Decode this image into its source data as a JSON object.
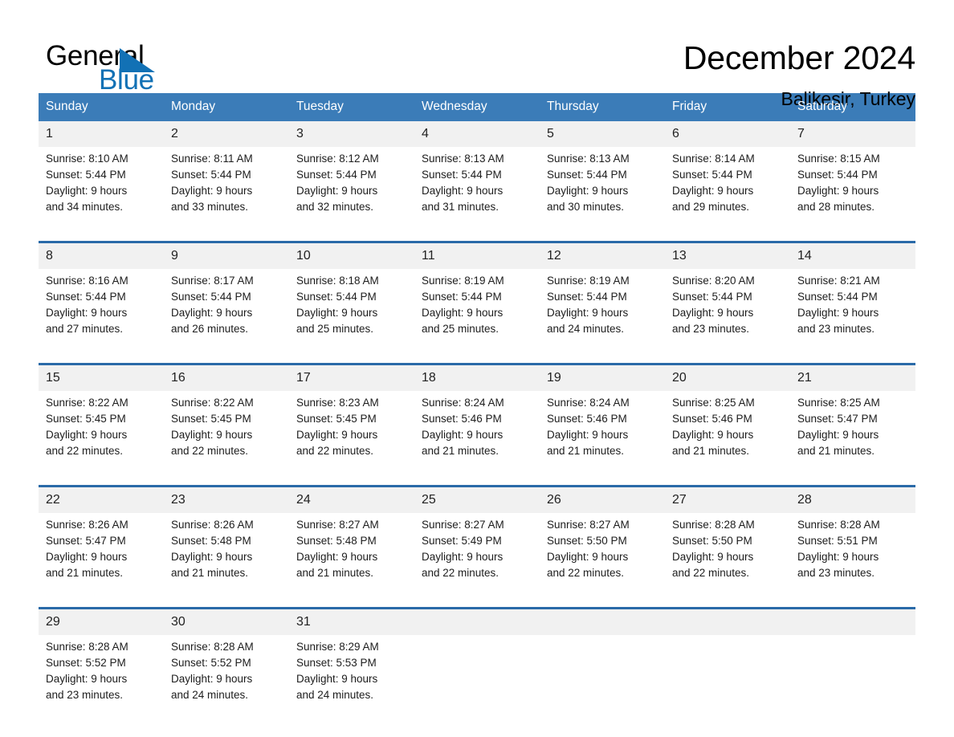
{
  "brand": {
    "name_part1": "General",
    "name_part2": "Blue",
    "accent_color": "#1271B5"
  },
  "header": {
    "month_title": "December 2024",
    "location_title": "Balikesir, Turkey"
  },
  "calendar": {
    "header_bg": "#3B7CB8",
    "row_divider_color": "#2A6AA8",
    "daynum_bg": "#F1F1F1",
    "weekdays": [
      "Sunday",
      "Monday",
      "Tuesday",
      "Wednesday",
      "Thursday",
      "Friday",
      "Saturday"
    ],
    "weeks": [
      {
        "days": [
          {
            "num": "1",
            "sunrise": "Sunrise: 8:10 AM",
            "sunset": "Sunset: 5:44 PM",
            "daylight1": "Daylight: 9 hours",
            "daylight2": "and 34 minutes."
          },
          {
            "num": "2",
            "sunrise": "Sunrise: 8:11 AM",
            "sunset": "Sunset: 5:44 PM",
            "daylight1": "Daylight: 9 hours",
            "daylight2": "and 33 minutes."
          },
          {
            "num": "3",
            "sunrise": "Sunrise: 8:12 AM",
            "sunset": "Sunset: 5:44 PM",
            "daylight1": "Daylight: 9 hours",
            "daylight2": "and 32 minutes."
          },
          {
            "num": "4",
            "sunrise": "Sunrise: 8:13 AM",
            "sunset": "Sunset: 5:44 PM",
            "daylight1": "Daylight: 9 hours",
            "daylight2": "and 31 minutes."
          },
          {
            "num": "5",
            "sunrise": "Sunrise: 8:13 AM",
            "sunset": "Sunset: 5:44 PM",
            "daylight1": "Daylight: 9 hours",
            "daylight2": "and 30 minutes."
          },
          {
            "num": "6",
            "sunrise": "Sunrise: 8:14 AM",
            "sunset": "Sunset: 5:44 PM",
            "daylight1": "Daylight: 9 hours",
            "daylight2": "and 29 minutes."
          },
          {
            "num": "7",
            "sunrise": "Sunrise: 8:15 AM",
            "sunset": "Sunset: 5:44 PM",
            "daylight1": "Daylight: 9 hours",
            "daylight2": "and 28 minutes."
          }
        ]
      },
      {
        "days": [
          {
            "num": "8",
            "sunrise": "Sunrise: 8:16 AM",
            "sunset": "Sunset: 5:44 PM",
            "daylight1": "Daylight: 9 hours",
            "daylight2": "and 27 minutes."
          },
          {
            "num": "9",
            "sunrise": "Sunrise: 8:17 AM",
            "sunset": "Sunset: 5:44 PM",
            "daylight1": "Daylight: 9 hours",
            "daylight2": "and 26 minutes."
          },
          {
            "num": "10",
            "sunrise": "Sunrise: 8:18 AM",
            "sunset": "Sunset: 5:44 PM",
            "daylight1": "Daylight: 9 hours",
            "daylight2": "and 25 minutes."
          },
          {
            "num": "11",
            "sunrise": "Sunrise: 8:19 AM",
            "sunset": "Sunset: 5:44 PM",
            "daylight1": "Daylight: 9 hours",
            "daylight2": "and 25 minutes."
          },
          {
            "num": "12",
            "sunrise": "Sunrise: 8:19 AM",
            "sunset": "Sunset: 5:44 PM",
            "daylight1": "Daylight: 9 hours",
            "daylight2": "and 24 minutes."
          },
          {
            "num": "13",
            "sunrise": "Sunrise: 8:20 AM",
            "sunset": "Sunset: 5:44 PM",
            "daylight1": "Daylight: 9 hours",
            "daylight2": "and 23 minutes."
          },
          {
            "num": "14",
            "sunrise": "Sunrise: 8:21 AM",
            "sunset": "Sunset: 5:44 PM",
            "daylight1": "Daylight: 9 hours",
            "daylight2": "and 23 minutes."
          }
        ]
      },
      {
        "days": [
          {
            "num": "15",
            "sunrise": "Sunrise: 8:22 AM",
            "sunset": "Sunset: 5:45 PM",
            "daylight1": "Daylight: 9 hours",
            "daylight2": "and 22 minutes."
          },
          {
            "num": "16",
            "sunrise": "Sunrise: 8:22 AM",
            "sunset": "Sunset: 5:45 PM",
            "daylight1": "Daylight: 9 hours",
            "daylight2": "and 22 minutes."
          },
          {
            "num": "17",
            "sunrise": "Sunrise: 8:23 AM",
            "sunset": "Sunset: 5:45 PM",
            "daylight1": "Daylight: 9 hours",
            "daylight2": "and 22 minutes."
          },
          {
            "num": "18",
            "sunrise": "Sunrise: 8:24 AM",
            "sunset": "Sunset: 5:46 PM",
            "daylight1": "Daylight: 9 hours",
            "daylight2": "and 21 minutes."
          },
          {
            "num": "19",
            "sunrise": "Sunrise: 8:24 AM",
            "sunset": "Sunset: 5:46 PM",
            "daylight1": "Daylight: 9 hours",
            "daylight2": "and 21 minutes."
          },
          {
            "num": "20",
            "sunrise": "Sunrise: 8:25 AM",
            "sunset": "Sunset: 5:46 PM",
            "daylight1": "Daylight: 9 hours",
            "daylight2": "and 21 minutes."
          },
          {
            "num": "21",
            "sunrise": "Sunrise: 8:25 AM",
            "sunset": "Sunset: 5:47 PM",
            "daylight1": "Daylight: 9 hours",
            "daylight2": "and 21 minutes."
          }
        ]
      },
      {
        "days": [
          {
            "num": "22",
            "sunrise": "Sunrise: 8:26 AM",
            "sunset": "Sunset: 5:47 PM",
            "daylight1": "Daylight: 9 hours",
            "daylight2": "and 21 minutes."
          },
          {
            "num": "23",
            "sunrise": "Sunrise: 8:26 AM",
            "sunset": "Sunset: 5:48 PM",
            "daylight1": "Daylight: 9 hours",
            "daylight2": "and 21 minutes."
          },
          {
            "num": "24",
            "sunrise": "Sunrise: 8:27 AM",
            "sunset": "Sunset: 5:48 PM",
            "daylight1": "Daylight: 9 hours",
            "daylight2": "and 21 minutes."
          },
          {
            "num": "25",
            "sunrise": "Sunrise: 8:27 AM",
            "sunset": "Sunset: 5:49 PM",
            "daylight1": "Daylight: 9 hours",
            "daylight2": "and 22 minutes."
          },
          {
            "num": "26",
            "sunrise": "Sunrise: 8:27 AM",
            "sunset": "Sunset: 5:50 PM",
            "daylight1": "Daylight: 9 hours",
            "daylight2": "and 22 minutes."
          },
          {
            "num": "27",
            "sunrise": "Sunrise: 8:28 AM",
            "sunset": "Sunset: 5:50 PM",
            "daylight1": "Daylight: 9 hours",
            "daylight2": "and 22 minutes."
          },
          {
            "num": "28",
            "sunrise": "Sunrise: 8:28 AM",
            "sunset": "Sunset: 5:51 PM",
            "daylight1": "Daylight: 9 hours",
            "daylight2": "and 23 minutes."
          }
        ]
      },
      {
        "days": [
          {
            "num": "29",
            "sunrise": "Sunrise: 8:28 AM",
            "sunset": "Sunset: 5:52 PM",
            "daylight1": "Daylight: 9 hours",
            "daylight2": "and 23 minutes."
          },
          {
            "num": "30",
            "sunrise": "Sunrise: 8:28 AM",
            "sunset": "Sunset: 5:52 PM",
            "daylight1": "Daylight: 9 hours",
            "daylight2": "and 24 minutes."
          },
          {
            "num": "31",
            "sunrise": "Sunrise: 8:29 AM",
            "sunset": "Sunset: 5:53 PM",
            "daylight1": "Daylight: 9 hours",
            "daylight2": "and 24 minutes."
          },
          {
            "num": "",
            "sunrise": "",
            "sunset": "",
            "daylight1": "",
            "daylight2": ""
          },
          {
            "num": "",
            "sunrise": "",
            "sunset": "",
            "daylight1": "",
            "daylight2": ""
          },
          {
            "num": "",
            "sunrise": "",
            "sunset": "",
            "daylight1": "",
            "daylight2": ""
          },
          {
            "num": "",
            "sunrise": "",
            "sunset": "",
            "daylight1": "",
            "daylight2": ""
          }
        ]
      }
    ]
  }
}
